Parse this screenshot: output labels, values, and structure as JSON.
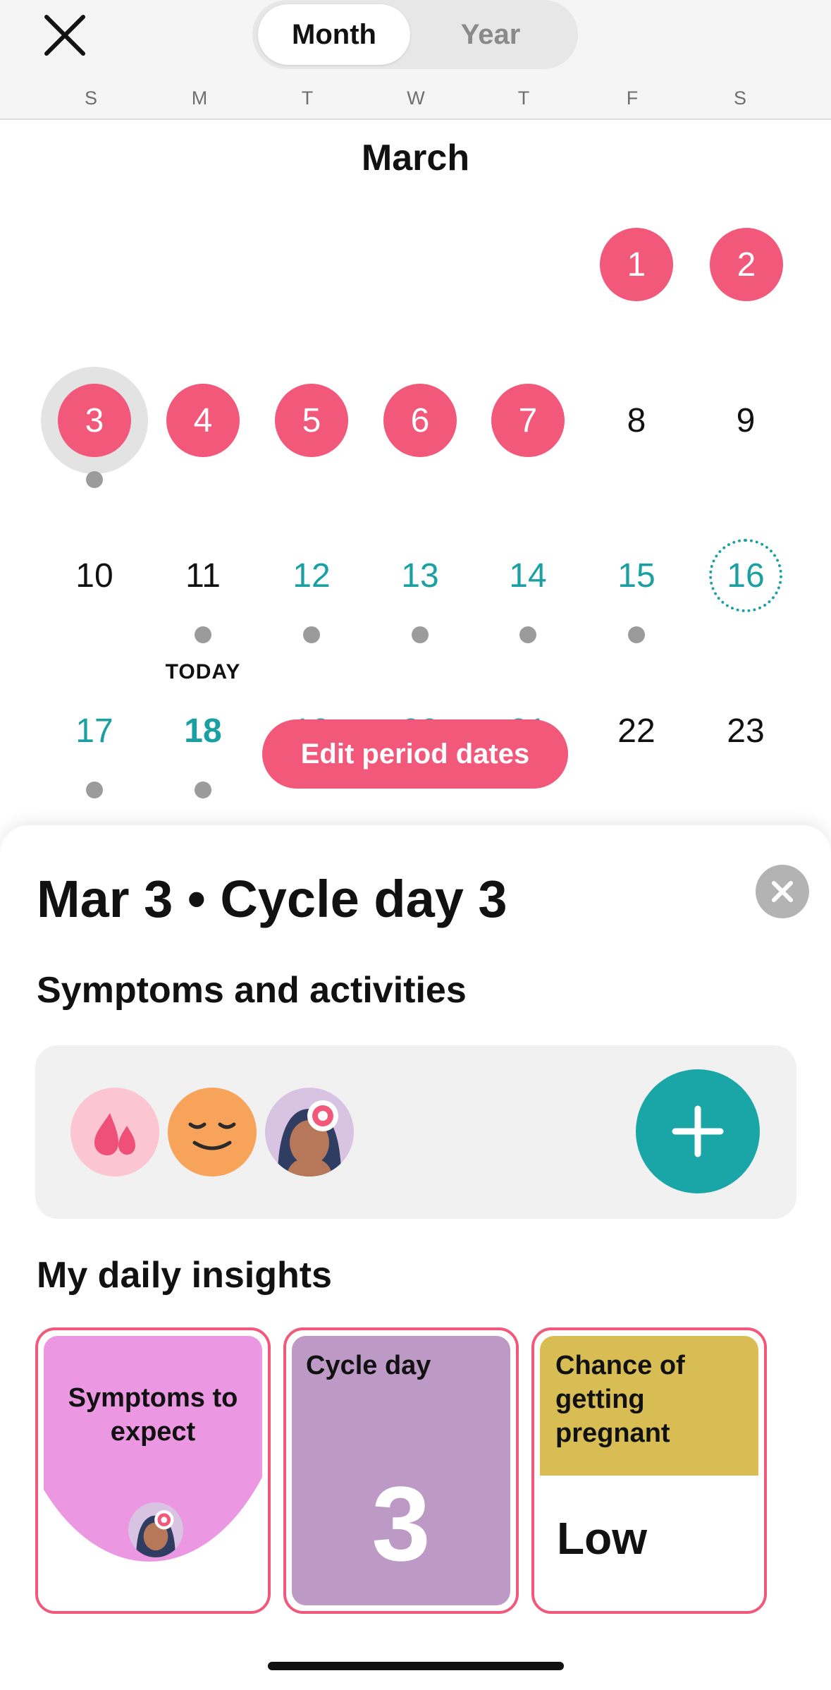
{
  "header": {
    "close_icon": "close-icon",
    "segments": [
      {
        "label": "Month",
        "selected": true
      },
      {
        "label": "Year",
        "selected": false
      }
    ],
    "weekdays": [
      "S",
      "M",
      "T",
      "W",
      "T",
      "F",
      "S"
    ]
  },
  "calendar": {
    "month": "March",
    "days": [
      "1",
      "2",
      "3",
      "4",
      "5",
      "6",
      "7",
      "8",
      "9",
      "10",
      "11",
      "12",
      "13",
      "14",
      "15",
      "16",
      "17",
      "18",
      "19",
      "20",
      "21",
      "22",
      "23"
    ],
    "period_days": [
      1,
      2,
      3,
      4,
      5,
      6,
      7
    ],
    "fertile_days": [
      12,
      13,
      14,
      15,
      16,
      17
    ],
    "ovulation_day": 16,
    "today": 18,
    "selected_day": 3,
    "logged_days": [
      3,
      11,
      12,
      13,
      14,
      15,
      17,
      18
    ],
    "today_label": "TODAY",
    "edit_button": "Edit period dates",
    "colors": {
      "period": "#f25879",
      "fertile": "#1aa0a3"
    }
  },
  "sheet": {
    "title": "Mar 3 • Cycle day 3",
    "symptoms_heading": "Symptoms and activities",
    "symptom_icons": [
      "blood-drop-icon",
      "calm-face-icon",
      "avatar-icon"
    ],
    "add_icon": "plus-icon",
    "insights_heading": "My daily insights",
    "insights": [
      {
        "title": "Symptoms to expect",
        "icon": "avatar-icon",
        "color": "#ec97e2"
      },
      {
        "title": "Cycle day",
        "value": "3",
        "color": "#bd9ac6"
      },
      {
        "title": "Chance of getting pregnant",
        "value": "Low",
        "color": "#d8bd55"
      }
    ]
  }
}
